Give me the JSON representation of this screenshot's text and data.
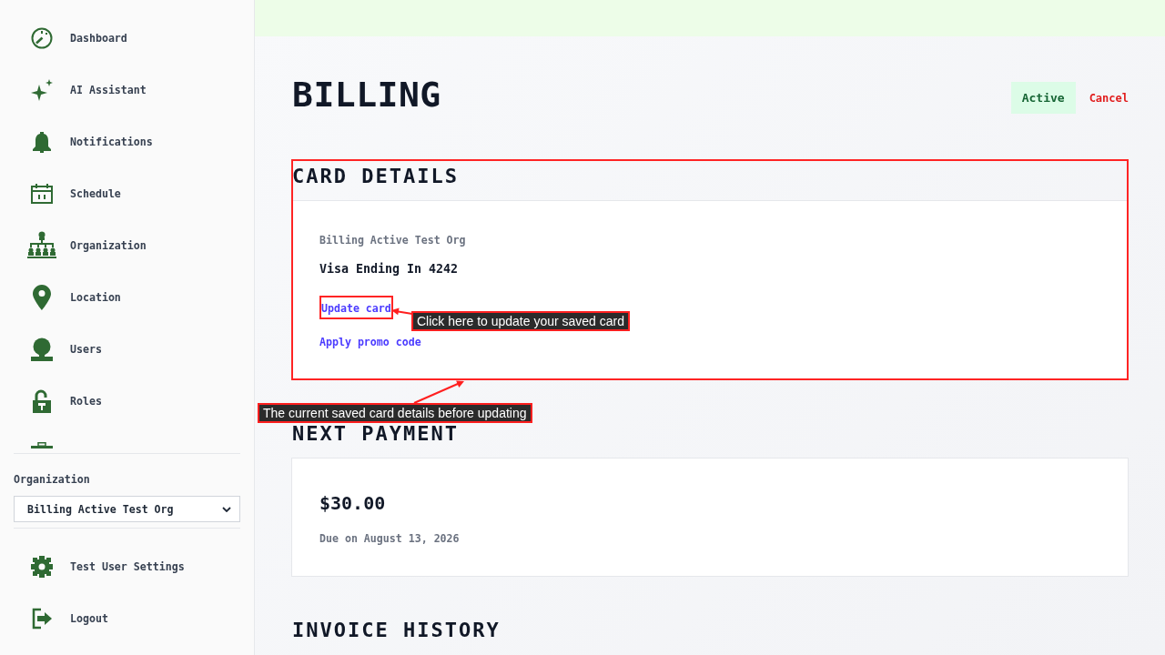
{
  "sidebar": {
    "nav_items": [
      {
        "label": "Dashboard"
      },
      {
        "label": "AI Assistant"
      },
      {
        "label": "Notifications"
      },
      {
        "label": "Schedule"
      },
      {
        "label": "Organization"
      },
      {
        "label": "Location"
      },
      {
        "label": "Users"
      },
      {
        "label": "Roles"
      }
    ],
    "organization_label": "Organization",
    "organization_select": {
      "value": "Billing Active Test Org"
    },
    "footer_items": [
      {
        "label": "Test User Settings"
      },
      {
        "label": "Logout"
      }
    ]
  },
  "header": {
    "title": "BILLING",
    "status_badge": "Active",
    "cancel_link": "Cancel"
  },
  "card_details": {
    "title": "CARD DETAILS",
    "org_name": "Billing Active Test Org",
    "card": "Visa Ending In 4242",
    "links": [
      {
        "label": "Update card",
        "annotation": "Click here to update your saved card"
      },
      {
        "label": "Apply promo code"
      }
    ],
    "annotation": "The current saved card details before updating"
  },
  "next_payment": {
    "title": "NEXT PAYMENT",
    "amount": "$30.00",
    "due": "Due on August 13, 2026"
  },
  "invoice_history": {
    "title": "INVOICE HISTORY"
  }
}
